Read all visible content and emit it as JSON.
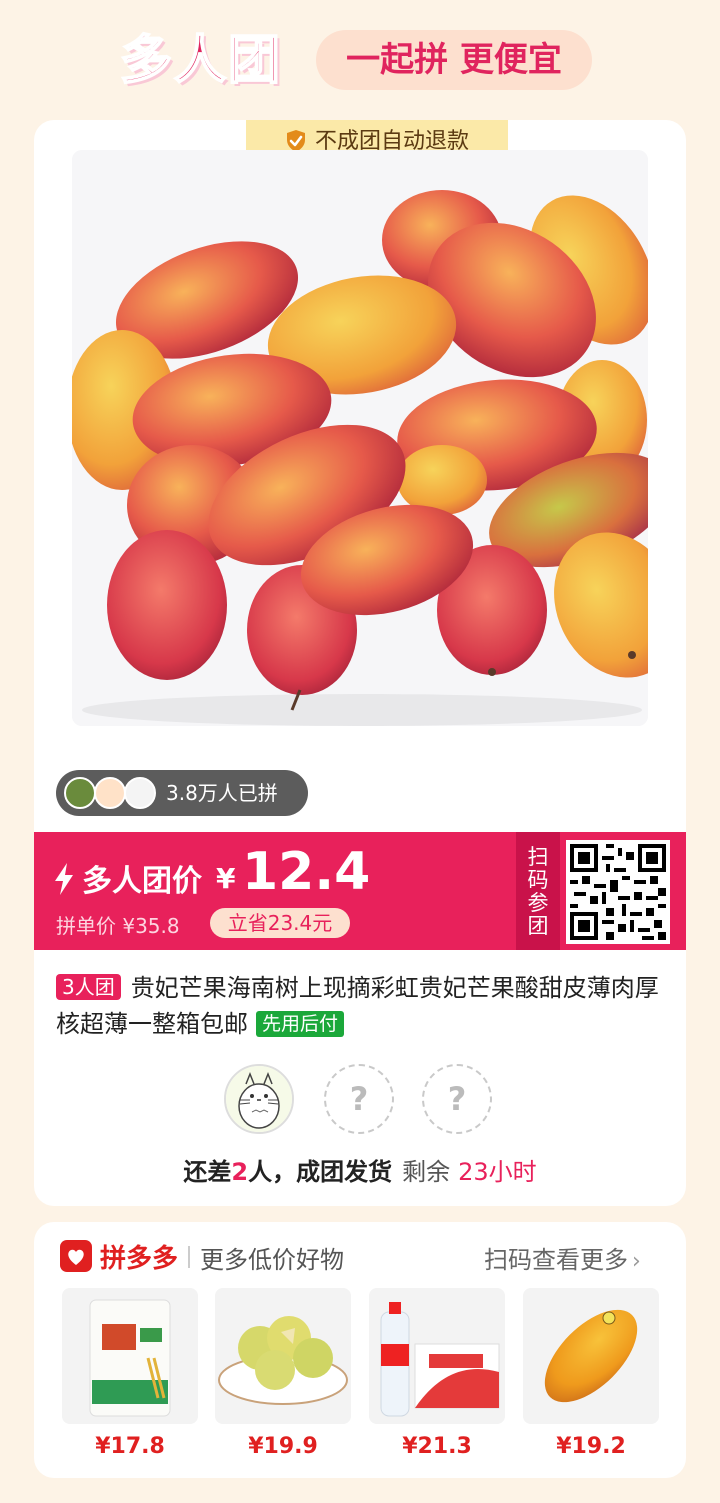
{
  "header": {
    "brand": "多人团",
    "slogan": "一起拼 更便宜"
  },
  "card": {
    "refund_badge": "不成团自动退款",
    "joined_text": "3.8万人已拼",
    "price": {
      "label": "多人团价",
      "currency": "¥",
      "value": "12.4",
      "single_price_text": "拼单价 ¥35.8",
      "save_text": "立省23.4元"
    },
    "scan_to_join": "扫码参团",
    "team_tag": "3人团",
    "title": "贵妃芒果海南树上现摘彩虹贵妃芒果酸甜皮薄肉厚核超薄一整箱包邮",
    "pay_later_tag": "先用后付",
    "slot_placeholder": "?",
    "status": {
      "prefix": "还差",
      "count": "2",
      "suffix": "人，成团发货",
      "remaining_label": "剩余",
      "remaining_time": "23小时"
    }
  },
  "more": {
    "brand": "拼多多",
    "subtitle": "更多低价好物",
    "scan_more": "扫码查看更多",
    "products": [
      {
        "name": "flour-bag",
        "price": "¥17.8"
      },
      {
        "name": "pears-plate",
        "price": "¥19.9"
      },
      {
        "name": "water-bottles",
        "price": "¥21.3"
      },
      {
        "name": "mango",
        "price": "¥19.2"
      }
    ]
  },
  "colors": {
    "accent": "#e8215b",
    "background": "#fdf3e6",
    "pay_later": "#1ba83a"
  }
}
